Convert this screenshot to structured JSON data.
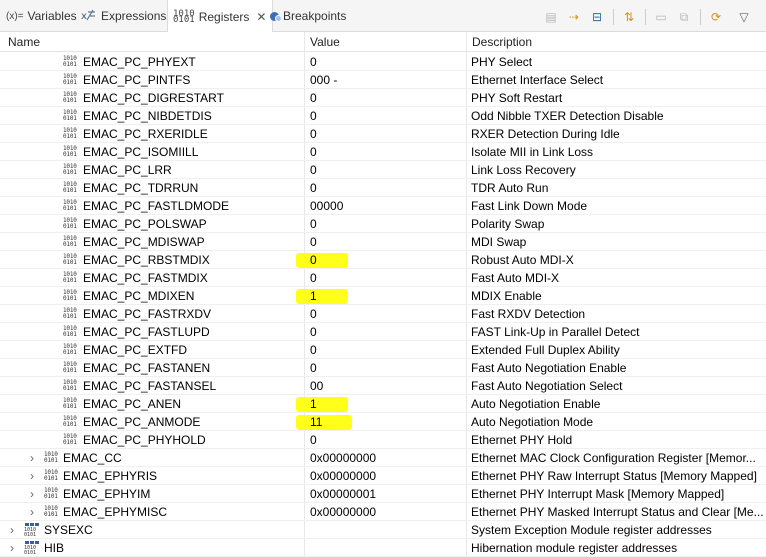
{
  "tabs": [
    {
      "icon": "(x)=",
      "label": "Variables"
    },
    {
      "icon": "expressions-icon",
      "label": "Expressions"
    },
    {
      "icon": "registers-icon",
      "label": "Registers",
      "active": true
    },
    {
      "icon": "breakpoints-icon",
      "label": "Breakpoints"
    }
  ],
  "columns": {
    "name": "Name",
    "value": "Value",
    "description": "Description"
  },
  "rows": [
    {
      "name": "EMAC_PC_PHYEXT",
      "value": "0",
      "description": "PHY Select"
    },
    {
      "name": "EMAC_PC_PINTFS",
      "value": "000 -",
      "description": "Ethernet Interface Select"
    },
    {
      "name": "EMAC_PC_DIGRESTART",
      "value": "0",
      "description": "PHY Soft Restart"
    },
    {
      "name": "EMAC_PC_NIBDETDIS",
      "value": "0",
      "description": "Odd Nibble TXER Detection Disable"
    },
    {
      "name": "EMAC_PC_RXERIDLE",
      "value": "0",
      "description": "RXER Detection During Idle"
    },
    {
      "name": "EMAC_PC_ISOMIILL",
      "value": "0",
      "description": "Isolate MII in Link Loss"
    },
    {
      "name": "EMAC_PC_LRR",
      "value": "0",
      "description": "Link Loss Recovery"
    },
    {
      "name": "EMAC_PC_TDRRUN",
      "value": "0",
      "description": "TDR Auto Run"
    },
    {
      "name": "EMAC_PC_FASTLDMODE",
      "value": "00000",
      "description": "Fast Link Down Mode"
    },
    {
      "name": "EMAC_PC_POLSWAP",
      "value": "0",
      "description": "Polarity Swap"
    },
    {
      "name": "EMAC_PC_MDISWAP",
      "value": "0",
      "description": "MDI Swap"
    },
    {
      "name": "EMAC_PC_RBSTMDIX",
      "value": "0",
      "description": "Robust Auto MDI-X",
      "highlight": true
    },
    {
      "name": "EMAC_PC_FASTMDIX",
      "value": "0",
      "description": "Fast Auto MDI-X"
    },
    {
      "name": "EMAC_PC_MDIXEN",
      "value": "1",
      "description": "MDIX Enable",
      "highlight": true
    },
    {
      "name": "EMAC_PC_FASTRXDV",
      "value": "0",
      "description": "Fast RXDV Detection"
    },
    {
      "name": "EMAC_PC_FASTLUPD",
      "value": "0",
      "description": "FAST Link-Up in Parallel Detect"
    },
    {
      "name": "EMAC_PC_EXTFD",
      "value": "0",
      "description": "Extended Full Duplex Ability"
    },
    {
      "name": "EMAC_PC_FASTANEN",
      "value": "0",
      "description": "Fast Auto Negotiation Enable"
    },
    {
      "name": "EMAC_PC_FASTANSEL",
      "value": "00",
      "description": "Fast Auto Negotiation Select"
    },
    {
      "name": "EMAC_PC_ANEN",
      "value": "1",
      "description": "Auto Negotiation Enable",
      "highlight": true
    },
    {
      "name": "EMAC_PC_ANMODE",
      "value": "11",
      "description": "Auto Negotiation Mode",
      "highlight": true
    },
    {
      "name": "EMAC_PC_PHYHOLD",
      "value": "0",
      "description": "Ethernet PHY Hold"
    },
    {
      "name": "EMAC_CC",
      "value": "0x00000000",
      "description": "Ethernet MAC Clock Configuration Register [Memor...",
      "expandable": true
    },
    {
      "name": "EMAC_EPHYRIS",
      "value": "0x00000000",
      "description": "Ethernet PHY Raw Interrupt Status [Memory Mapped]",
      "expandable": true
    },
    {
      "name": "EMAC_EPHYIM",
      "value": "0x00000001",
      "description": "Ethernet PHY Interrupt Mask [Memory Mapped]",
      "expandable": true
    },
    {
      "name": "EMAC_EPHYMISC",
      "value": "0x00000000",
      "description": "Ethernet PHY Masked Interrupt Status and Clear [Me...",
      "expandable": true
    },
    {
      "name": "SYSEXC",
      "value": "",
      "description": "System Exception Module register addresses",
      "expandable": true,
      "group": true
    },
    {
      "name": "HIB",
      "value": "",
      "description": "Hibernation module register addresses",
      "expandable": true,
      "group": true
    }
  ],
  "colors": {
    "highlight": "#ffff00",
    "tab_bg": "#f5f5f5"
  }
}
